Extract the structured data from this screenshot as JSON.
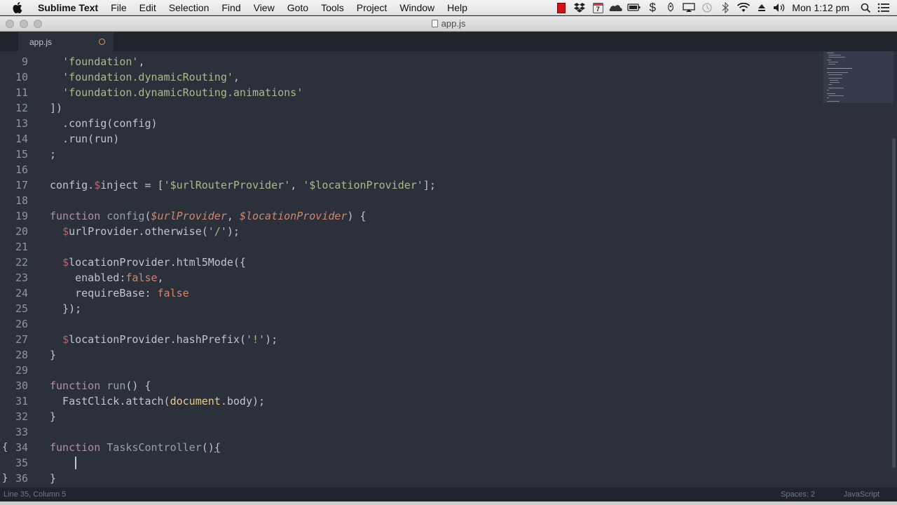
{
  "menubar": {
    "app_name": "Sublime Text",
    "items": [
      "File",
      "Edit",
      "Selection",
      "Find",
      "View",
      "Goto",
      "Tools",
      "Project",
      "Window",
      "Help"
    ],
    "status_icons": [
      "record-icon",
      "dropbox-icon",
      "calendar-icon",
      "cloud-icon",
      "battery-icon",
      "dollar-icon",
      "rocket-icon",
      "airplay-icon",
      "time-machine-icon",
      "bluetooth-icon",
      "wifi-icon",
      "eject-icon",
      "volume-icon"
    ],
    "calendar_day": "7",
    "clock": "Mon 1:12 pm"
  },
  "window": {
    "title": "app.js"
  },
  "tabs": [
    {
      "label": "app.js",
      "modified": true
    }
  ],
  "editor": {
    "lines": [
      {
        "num": "9",
        "text": "  'foundation',"
      },
      {
        "num": "10",
        "text": "  'foundation.dynamicRouting',"
      },
      {
        "num": "11",
        "text": "  'foundation.dynamicRouting.animations'"
      },
      {
        "num": "12",
        "text": "])"
      },
      {
        "num": "13",
        "text": "  .config(config)"
      },
      {
        "num": "14",
        "text": "  .run(run)"
      },
      {
        "num": "15",
        "text": ";"
      },
      {
        "num": "16",
        "text": ""
      },
      {
        "num": "17",
        "text": "config.$inject = ['$urlRouterProvider', '$locationProvider'];"
      },
      {
        "num": "18",
        "text": ""
      },
      {
        "num": "19",
        "text": "function config($urlProvider, $locationProvider) {"
      },
      {
        "num": "20",
        "text": "  $urlProvider.otherwise('/');"
      },
      {
        "num": "21",
        "text": ""
      },
      {
        "num": "22",
        "text": "  $locationProvider.html5Mode({"
      },
      {
        "num": "23",
        "text": "    enabled:false,"
      },
      {
        "num": "24",
        "text": "    requireBase: false"
      },
      {
        "num": "25",
        "text": "  });"
      },
      {
        "num": "26",
        "text": ""
      },
      {
        "num": "27",
        "text": "  $locationProvider.hashPrefix('!');"
      },
      {
        "num": "28",
        "text": "}"
      },
      {
        "num": "29",
        "text": ""
      },
      {
        "num": "30",
        "text": "function run() {"
      },
      {
        "num": "31",
        "text": "  FastClick.attach(document.body);"
      },
      {
        "num": "32",
        "text": "}"
      },
      {
        "num": "33",
        "text": ""
      },
      {
        "num": "34",
        "text": "function TasksController(){"
      },
      {
        "num": "35",
        "text": ""
      },
      {
        "num": "36",
        "text": "}"
      }
    ],
    "fold_open": "{",
    "fold_close": "}"
  },
  "statusbar": {
    "position": "Line 35, Column 5",
    "indentation": "Spaces: 2",
    "syntax": "JavaScript"
  }
}
